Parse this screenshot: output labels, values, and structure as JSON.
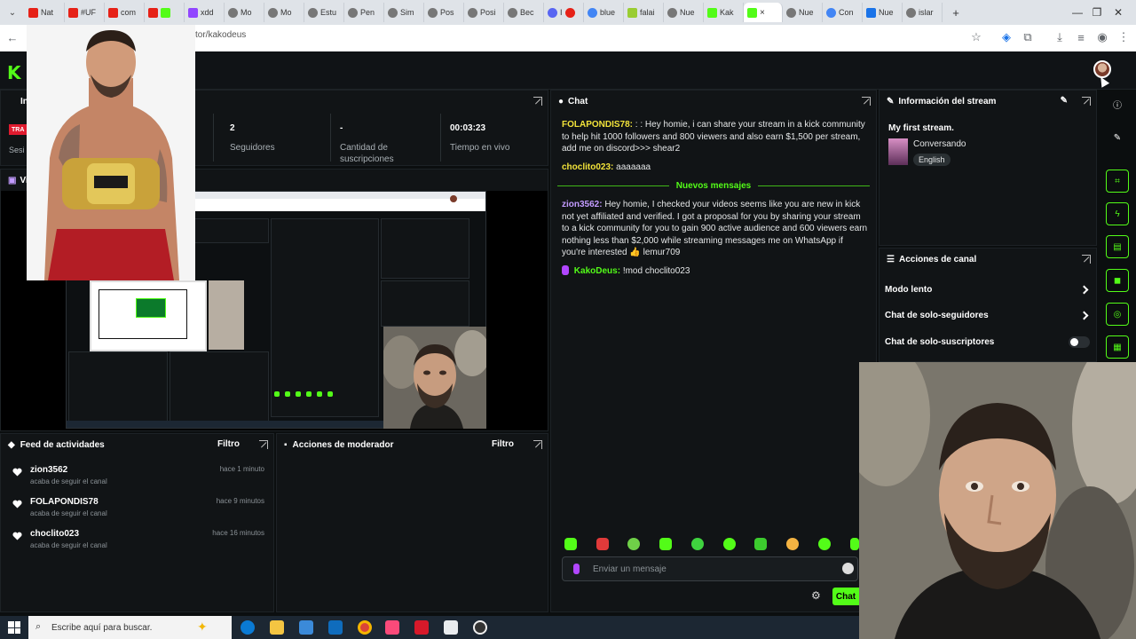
{
  "browser": {
    "tabs": [
      "Nat",
      "#UF",
      "com",
      "",
      "xdd",
      "Mo",
      "Mo",
      "Estu",
      "Pen",
      "Sim",
      "Pos",
      "Posi",
      "Bec",
      "I",
      "blue",
      "falai",
      "Nue",
      "Kak",
      "",
      "Nue",
      "Con",
      "Nue",
      "islar"
    ],
    "url": "tor/kakodeus",
    "new_tab": "+",
    "close_tab": "×"
  },
  "kick": {
    "logo": "K"
  },
  "stats": {
    "tag": "TRA",
    "session_label": "Sesi",
    "panel_title": "In",
    "panel2_title": "Vi",
    "followers_value": "2",
    "followers_label": "Seguidores",
    "subs_value": "-",
    "subs_label": "Cantidad de suscripciones",
    "live_value": "00:03:23",
    "live_label": "Tiempo en vivo"
  },
  "chat": {
    "title": "Chat",
    "messages": [
      {
        "user": "FOLAPONDIS78:",
        "text": ": : Hey homie, i can share your stream in a kick community to help hit 1000 followers and 800 viewers and also earn $1,500 per stream, add me on discord>>> shear2"
      },
      {
        "user": "choclito023:",
        "text": "aaaaaaa"
      }
    ],
    "new_messages_label": "Nuevos mensajes",
    "messages_after": [
      {
        "user": "zion3562:",
        "text": "Hey homie, I checked your videos seems like you are new in kick not yet affiliated and verified. I got a proposal for you by sharing your stream to a kick community for you to gain 900 active audience and 600 viewers earn nothing less than $2,000 while streaming messages me on WhatsApp if you're interested 👍 lemur709"
      },
      {
        "user": "KakoDeus:",
        "text": "!mod choclito023"
      }
    ],
    "input_placeholder": "Enviar un mensaje",
    "send_label": "Chat"
  },
  "stream_info": {
    "title": "Información del stream",
    "stream_title": "My first stream.",
    "category": "Conversando",
    "language": "English"
  },
  "channel_actions": {
    "title": "Acciones de canal",
    "items": [
      "Modo lento",
      "Chat de solo-seguidores",
      "Chat de solo-suscriptores"
    ]
  },
  "feed": {
    "title": "Feed de actividades",
    "filter": "Filtro",
    "items": [
      {
        "name": "zion3562",
        "sub": "acaba de seguir el canal",
        "time": "hace 1 minuto"
      },
      {
        "name": "FOLAPONDIS78",
        "sub": "acaba de seguir el canal",
        "time": "hace 9 minutos"
      },
      {
        "name": "choclito023",
        "sub": "acaba de seguir el canal",
        "time": "hace 16 minutos"
      }
    ]
  },
  "mod_actions": {
    "title": "Acciones de moderador",
    "filter": "Filtro"
  },
  "taskbar": {
    "search_placeholder": "Escribe aquí para buscar."
  },
  "colors": {
    "kick_green": "#53fc18",
    "panel_bg": "#111416",
    "chat_user_yellow": "#f2e33a",
    "chat_user_purple": "#c39bff",
    "chat_user_green": "#53fc18"
  }
}
